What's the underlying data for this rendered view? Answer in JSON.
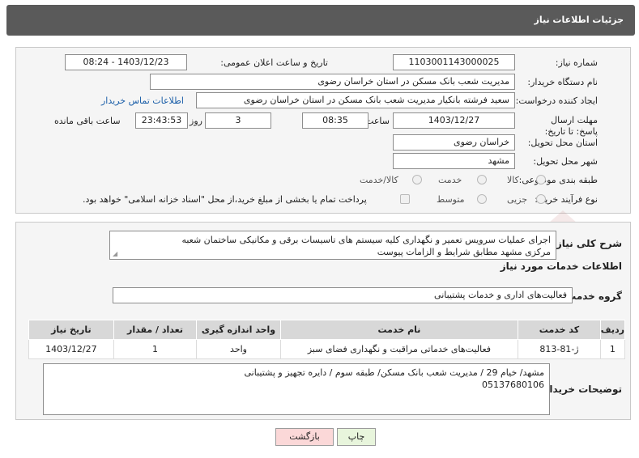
{
  "header": {
    "title": "جزئیات اطلاعات نیاز"
  },
  "need": {
    "number_label": "شماره نیاز:",
    "number": "1103001143000025",
    "announce_label": "تاریخ و ساعت اعلان عمومی:",
    "announce": "1403/12/23 - 08:24",
    "buyer_label": "نام دستگاه خریدار:",
    "buyer": "مدیریت شعب بانک مسکن در استان خراسان رضوی",
    "creator_label": "ایجاد کننده درخواست:",
    "creator": "سعید فرشته بانکیار مدیریت شعب بانک مسکن در استان خراسان رضوی",
    "contact_link": "اطلاعات تماس خریدار",
    "deadline_label": "مهلت ارسال پاسخ: تا تاریخ:",
    "deadline_date": "1403/12/27",
    "time_label": "ساعت",
    "deadline_time": "08:35",
    "days": "3",
    "days_label": "روز و",
    "remaining": "23:43:53",
    "remaining_label": "ساعت باقی مانده",
    "province_label": "استان محل تحویل:",
    "province": "خراسان رضوی",
    "city_label": "شهر محل تحویل:",
    "city": "مشهد",
    "category_label": "طبقه بندی موضوعی:",
    "category_options": [
      "کالا",
      "خدمت",
      "کالا/خدمت"
    ],
    "process_label": "نوع فرآیند خرید :",
    "process_options": [
      "جزیی",
      "متوسط"
    ],
    "payment_note": "پرداخت تمام یا بخشی از مبلغ خرید،از محل \"اسناد خزانه اسلامی\" خواهد بود."
  },
  "details": {
    "summary_label": "شرح کلی نیاز:",
    "summary_line1": "اجرای عملیات سرویس تعمیر و نگهداری کلیه سیستم های تاسیسات برقی و مکانیکی ساختمان شعبه",
    "summary_line2": "مرکزی مشهد مطابق شرایط و الزامات پیوست",
    "services_heading": "اطلاعات خدمات مورد نیاز",
    "group_label": "گروه خدمت:",
    "group": "فعالیت‌های اداری و خدمات پشتیبانی",
    "table": {
      "headers": [
        "ردیف",
        "کد خدمت",
        "نام خدمت",
        "واحد اندازه گیری",
        "تعداد / مقدار",
        "تاریخ نیاز"
      ],
      "rows": [
        [
          "1",
          "ژ-81-813",
          "فعالیت‌های خدماتی مراقبت و نگهداری فضای سبز",
          "واحد",
          "1",
          "1403/12/27"
        ]
      ]
    },
    "buyer_notes_label": "توضیحات خریدار:",
    "buyer_notes_line1": "مشهد/ خیام 29 / مدیریت شعب بانک مسکن/ طبقه سوم / دایره تجهیز و پشتیبانی",
    "buyer_notes_line2": "05137680106"
  },
  "buttons": {
    "print": "چاپ",
    "back": "بازگشت"
  },
  "colors": {
    "header_bg": "#5a5a5a",
    "print_bg": "#e8f5dc",
    "back_bg": "#fbd8d8",
    "link": "#1a5ea8"
  }
}
